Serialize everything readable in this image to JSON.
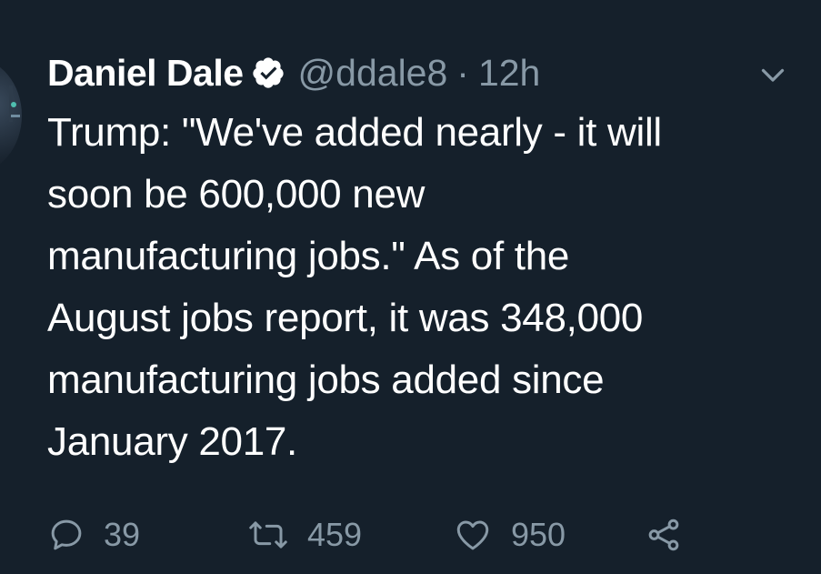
{
  "tweet": {
    "author": {
      "name": "Daniel Dale",
      "handle": "@ddale8",
      "separator": "·",
      "time": "12h",
      "verified": true
    },
    "lines": [
      "Trump: \"We've added nearly - it will",
      "soon be 600,000 new",
      "manufacturing jobs.\" As of the",
      "August jobs report, it was 348,000",
      "manufacturing jobs added since",
      "January 2017."
    ],
    "actions": {
      "reply_count": "39",
      "retweet_count": "459",
      "like_count": "950"
    },
    "icons": {
      "verified": "verified-badge-icon",
      "menu": "chevron-down-icon",
      "reply": "reply-bubble-icon",
      "retweet": "retweet-arrows-icon",
      "like": "heart-icon",
      "share": "share-nodes-icon"
    },
    "colors": {
      "background": "#15202b",
      "text": "#ffffff",
      "muted": "#8899a6"
    }
  }
}
